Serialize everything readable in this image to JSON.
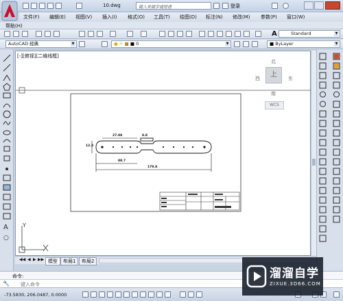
{
  "window": {
    "filename": "10.dwg",
    "search_placeholder": "键入关键字或短语",
    "login": "登录"
  },
  "menubar": {
    "items": [
      "文件(F)",
      "编辑(E)",
      "视图(V)",
      "插入(I)",
      "格式(O)",
      "工具(T)",
      "绘图(D)",
      "标注(N)",
      "修改(M)",
      "参数(P)",
      "窗口(W)"
    ],
    "help": "帮助(H)"
  },
  "toolbar": {
    "text_style": "Standard",
    "workspace": "AutoCAD 经典",
    "layer": "0",
    "color": "ByLayer"
  },
  "viewport": {
    "label": "[-][俯视][二维线框]",
    "viewcube": {
      "north": "北",
      "south": "南",
      "east": "东",
      "west": "西",
      "top": "上",
      "wcs": "WCS"
    }
  },
  "drawing": {
    "dims": {
      "d1": "27.98",
      "d2": "8.8",
      "d3": "12.3",
      "d4": "88.7",
      "d5": "179.8"
    }
  },
  "layout_tabs": [
    "模型",
    "布局1",
    "布局2"
  ],
  "command": {
    "history_label": "命令:",
    "input_placeholder": "键入命令"
  },
  "status": {
    "coordinates": "-73.5830, 206.0487, 0.0000"
  },
  "watermark": {
    "title": "溜溜自学",
    "url": "ZIXUE.3D66.COM"
  },
  "colors": {
    "accent": "#c8102e",
    "chrome": "#c9d4e3",
    "watermark_bg": "#1c2430"
  }
}
